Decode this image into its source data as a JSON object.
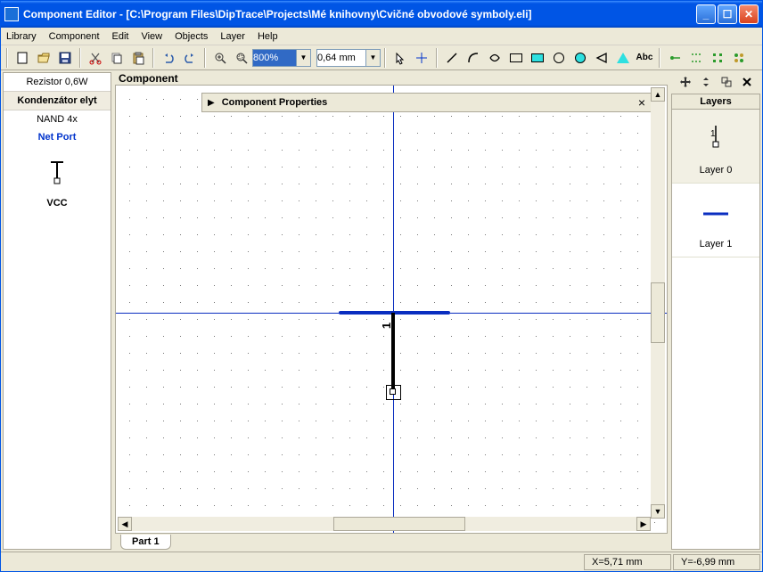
{
  "window": {
    "title": "Component Editor - [C:\\Program Files\\DipTrace\\Projects\\Mé knihovny\\Cvičné obvodové symboly.eli]"
  },
  "menu": {
    "items": [
      "Library",
      "Component",
      "Edit",
      "View",
      "Objects",
      "Layer",
      "Help"
    ]
  },
  "toolbar": {
    "zoom_value": "800%",
    "grid_value": "0,64 mm",
    "abc_label": "Abc"
  },
  "sidebar_left": {
    "items": [
      {
        "label": "Rezistor 0,6W",
        "selected": false
      },
      {
        "label": "Kondenzátor elyt",
        "selected": true
      },
      {
        "label": "NAND 4x",
        "selected": false
      }
    ],
    "netport_label": "Net Port",
    "symbol_label": "VCC"
  },
  "canvas": {
    "header": "Component",
    "props_bar": "Component Properties",
    "tab": "Part 1",
    "pin_label": "1"
  },
  "sidebar_right": {
    "header": "Layers",
    "layers": [
      "Layer 0",
      "Layer 1"
    ]
  },
  "status": {
    "x": "X=5,71 mm",
    "y": "Y=-6,99 mm"
  }
}
